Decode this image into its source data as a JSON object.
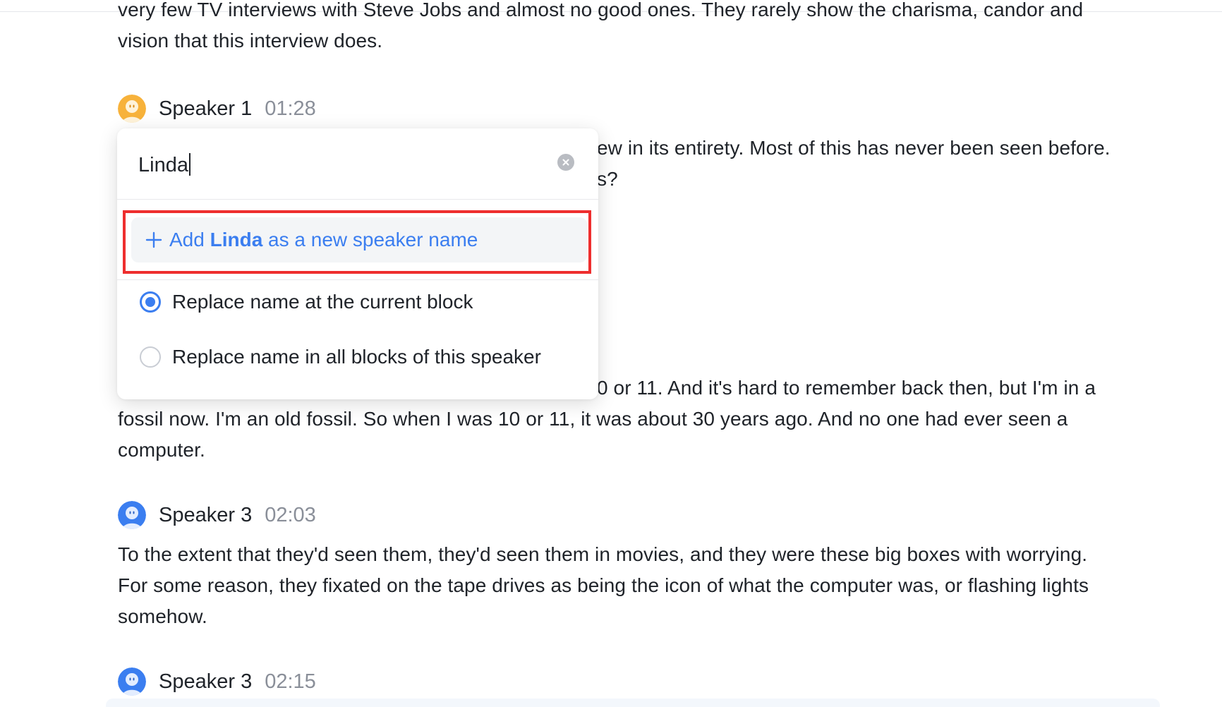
{
  "transcript": {
    "intro_line1": "very few TV interviews with Steve Jobs and almost no good ones. They rarely show the charisma, candor and",
    "intro_line2": "vision that this interview does.",
    "block1": {
      "speaker": "Speaker 1",
      "time": "01:28",
      "line1_visible": "ew in its entirety. Most of this has never been seen before.",
      "line2_visible": "s?"
    },
    "block2": {
      "line1_visible": "0 or 11. And it's hard to remember back then, but I'm in a",
      "line2": "fossil now. I'm an old fossil. So when I was 10 or 11, it was about 30 years ago. And no one had ever seen a",
      "line3": "computer."
    },
    "block3": {
      "speaker": "Speaker 3",
      "time": "02:03",
      "line1": "To the extent that they'd seen them, they'd seen them in movies, and they were these big boxes with worrying.",
      "line2": "For some reason, they fixated on the tape drives as being the icon of what the computer was, or flashing lights",
      "line3": "somehow."
    },
    "block4": {
      "speaker": "Speaker 3",
      "time": "02:15"
    }
  },
  "rename_popover": {
    "input_value": "Linda",
    "clear_icon": "clear-circle-icon",
    "add_option": {
      "icon": "plus-icon",
      "prefix": "Add ",
      "name": "Linda",
      "suffix": " as a new speaker name"
    },
    "options": [
      {
        "label": "Replace name at the current block",
        "checked": true
      },
      {
        "label": "Replace name in all blocks of this speaker",
        "checked": false
      }
    ]
  },
  "colors": {
    "accent": "#3b7ef0",
    "highlight_border": "#ee2e2e",
    "speaker1_avatar": "#f5a623",
    "speaker3_avatar": "#3b7ef0",
    "muted_text": "#8a8f99"
  }
}
